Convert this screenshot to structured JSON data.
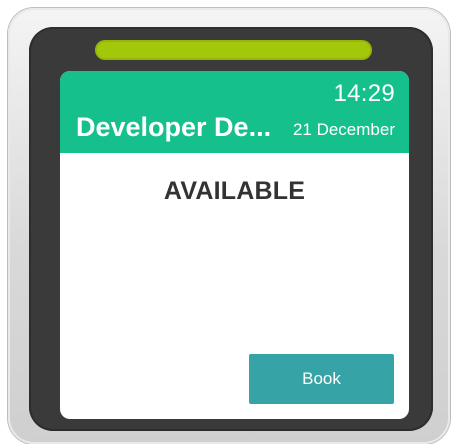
{
  "device": {
    "accent_bar_color": "#a3c70a",
    "header_color": "#16c08c",
    "button_color": "#36a3a6"
  },
  "header": {
    "time": "14:29",
    "room_name": "Developer De...",
    "date": "21 December"
  },
  "main": {
    "status": "AVAILABLE",
    "book_label": "Book"
  }
}
